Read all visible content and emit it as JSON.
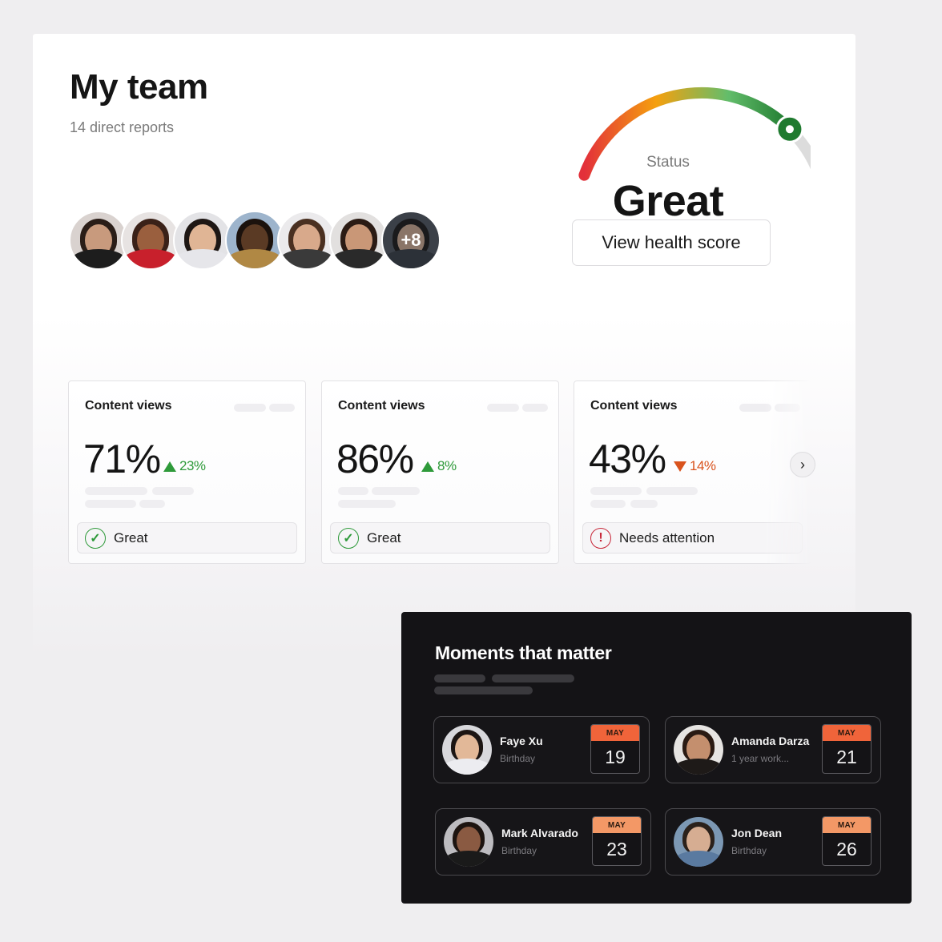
{
  "team": {
    "title": "My team",
    "subtitle": "14 direct reports",
    "avatars": [
      {
        "name": "team-member-1",
        "bg": "#d9d2cf",
        "skin": "#c89a7d",
        "hair": "#2a1d17",
        "shirt": "#1d1d1d"
      },
      {
        "name": "team-member-2",
        "bg": "#e7e3e2",
        "skin": "#9a5f3e",
        "hair": "#3a2118",
        "shirt": "#c8202c"
      },
      {
        "name": "team-member-3",
        "bg": "#e3e3e6",
        "skin": "#e0b595",
        "hair": "#1e1714",
        "shirt": "#e6e6ea"
      },
      {
        "name": "team-member-4",
        "bg": "#9db4cc",
        "skin": "#5a3a24",
        "hair": "#1b120d",
        "shirt": "#b08844"
      },
      {
        "name": "team-member-5",
        "bg": "#ebeaec",
        "skin": "#d8a98b",
        "hair": "#4a3021",
        "shirt": "#3a3a3a"
      },
      {
        "name": "team-member-6",
        "bg": "#e2e0df",
        "skin": "#c99777",
        "hair": "#2b1b14",
        "shirt": "#2a2a2a"
      },
      {
        "name": "team-member-7",
        "bg": "#3b4048",
        "skin": "#8a7568",
        "hair": "#1a1a1c",
        "shirt": "#2c3138"
      }
    ],
    "more_count": "+8"
  },
  "health": {
    "status_label": "Status",
    "status_value": "Great",
    "score_fraction": 0.82,
    "button_label": "View health score",
    "colors": {
      "low": "#e3303a",
      "mid": "#f5a00e",
      "high": "#63bd6b",
      "marker": "#1f7a2f",
      "track": "#dcdcdc"
    }
  },
  "metrics": {
    "cards": [
      {
        "title": "Content views",
        "value": "71%",
        "delta": "23%",
        "direction": "up",
        "status": "Great",
        "status_type": "ok"
      },
      {
        "title": "Content views",
        "value": "86%",
        "delta": "8%",
        "direction": "up",
        "status": "Great",
        "status_type": "ok"
      },
      {
        "title": "Content views",
        "value": "43%",
        "delta": "14%",
        "direction": "down",
        "status": "Needs attention",
        "status_type": "warn"
      }
    ],
    "next_icon": "›",
    "colors": {
      "up": "#2e9a3a",
      "down": "#d9531e",
      "warn": "#c8283a"
    }
  },
  "moments": {
    "title": "Moments that matter",
    "items": [
      {
        "name": "Faye Xu",
        "event": "Birthday",
        "month": "MAY",
        "day": "19",
        "month_color": "#f0643a",
        "avatar": {
          "bg": "#d8d8dc",
          "skin": "#e2b898",
          "hair": "#1c1513",
          "shirt": "#ececf0"
        }
      },
      {
        "name": "Amanda Darza",
        "event": "1 year work...",
        "month": "MAY",
        "day": "21",
        "month_color": "#f0643a",
        "avatar": {
          "bg": "#e6e4e2",
          "skin": "#c48f6e",
          "hair": "#2a1a13",
          "shirt": "#1e1a18"
        }
      },
      {
        "name": "Mark Alvarado",
        "event": "Birthday",
        "month": "MAY",
        "day": "23",
        "month_color": "#f39866",
        "avatar": {
          "bg": "#bdbcc0",
          "skin": "#8a5a42",
          "hair": "#1d1410",
          "shirt": "#1a1a1a"
        }
      },
      {
        "name": "Jon Dean",
        "event": "Birthday",
        "month": "MAY",
        "day": "26",
        "month_color": "#f39866",
        "avatar": {
          "bg": "#7c98b4",
          "skin": "#d6ad92",
          "hair": "#2b211b",
          "shirt": "#5a7aa0"
        }
      }
    ]
  }
}
